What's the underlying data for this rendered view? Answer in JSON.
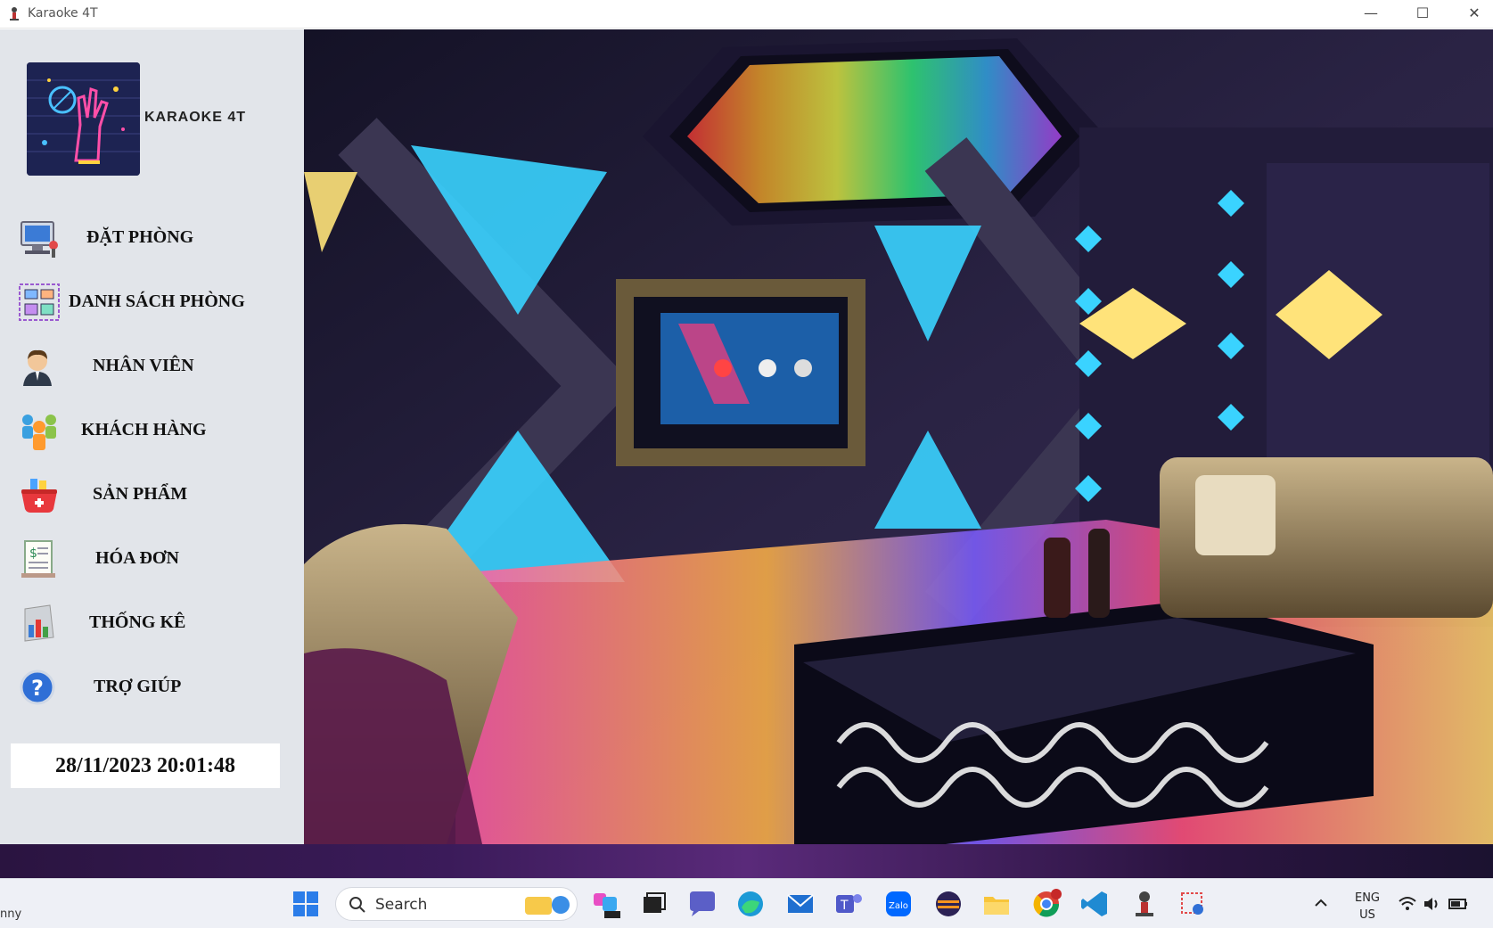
{
  "window": {
    "title": "Karaoke 4T",
    "minimize": "—",
    "maximize": "☐",
    "close": "✕"
  },
  "brand": {
    "name": "KARAOKE 4T"
  },
  "menu": [
    {
      "label": "ĐẶT PHÒNG",
      "icon": "booking-computer-icon"
    },
    {
      "label": "DANH SÁCH PHÒNG",
      "icon": "room-list-icon"
    },
    {
      "label": "NHÂN VIÊN",
      "icon": "employee-icon"
    },
    {
      "label": "KHÁCH HÀNG",
      "icon": "customers-icon"
    },
    {
      "label": "SẢN PHẨM",
      "icon": "products-basket-icon"
    },
    {
      "label": "HÓA ĐƠN",
      "icon": "invoice-icon"
    },
    {
      "label": "THỐNG KÊ",
      "icon": "statistics-chart-icon"
    },
    {
      "label": "TRỢ GIÚP",
      "icon": "help-icon"
    }
  ],
  "clock": {
    "datetime": "28/11/2023 20:01:48"
  },
  "taskbar": {
    "left_text": "nny",
    "search_placeholder": "Search",
    "language_top": "ENG",
    "language_bottom": "US"
  }
}
